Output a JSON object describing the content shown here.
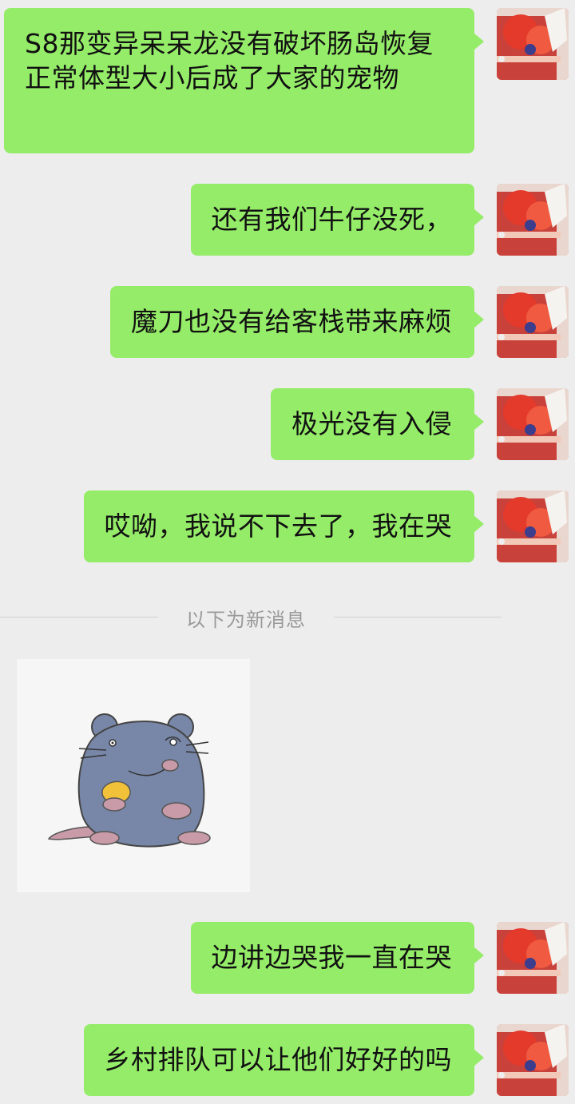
{
  "messages": [
    {
      "id": 1,
      "text": "S8那变异呆呆龙没有破坏肠岛恢复正常体型大小后成了大家的宠物"
    },
    {
      "id": 2,
      "text": "还有我们牛仔没死，"
    },
    {
      "id": 3,
      "text": "魔刀也没有给客栈带来麻烦"
    },
    {
      "id": 4,
      "text": "极光没有入侵"
    },
    {
      "id": 5,
      "text": "哎呦，我说不下去了，我在哭"
    },
    {
      "id": 6,
      "text": "边讲边哭我一直在哭"
    },
    {
      "id": 7,
      "text": "乡村排队可以让他们好好的吗"
    }
  ],
  "divider": {
    "label": "以下为新消息"
  },
  "sticker": {
    "icon": "gray-mouse-sticker"
  },
  "colors": {
    "background": "#ededed",
    "bubble": "#95ec69"
  }
}
